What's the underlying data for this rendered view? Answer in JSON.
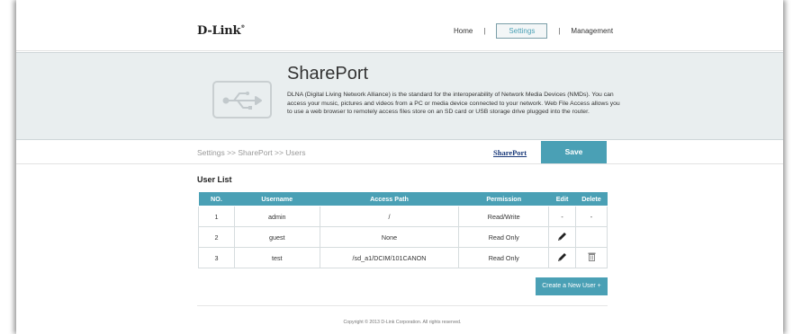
{
  "brand": {
    "logo": "D-Link",
    "logo_mark": "®"
  },
  "nav": {
    "home": "Home",
    "settings": "Settings",
    "management": "Management",
    "separator": "|"
  },
  "banner": {
    "title": "SharePort",
    "description": "DLNA (Digital Living Network Alliance) is the standard for the interoperability of Network Media Devices (NMDs). You can access your music, pictures and videos from a PC or media device connected to your network. Web File Access allows you to use a web browser to remotely access files store on an SD card or USB storage drive plugged into the router.",
    "icon": "usb-icon"
  },
  "breadcrumb": "Settings >> SharePort >> Users",
  "actions": {
    "shareport_link": "SharePort",
    "save": "Save",
    "create_user": "Create a New User +"
  },
  "section_title": "User List",
  "table": {
    "columns": [
      "NO.",
      "Username",
      "Access Path",
      "Permission",
      "Edit",
      "Delete"
    ],
    "rows": [
      {
        "no": "1",
        "username": "admin",
        "path": "/",
        "permission": "Read/Write",
        "edit": "-",
        "delete": "-"
      },
      {
        "no": "2",
        "username": "guest",
        "path": "None",
        "permission": "Read Only",
        "edit": "pencil-icon",
        "delete": ""
      },
      {
        "no": "3",
        "username": "test",
        "path": "/sd_a1/DCIM/101CANON",
        "permission": "Read Only",
        "edit": "pencil-icon",
        "delete": "trash-icon"
      }
    ]
  },
  "footer": {
    "copyright": "Copyright © 2013 D-Link Corporation. All rights reserved."
  },
  "colors": {
    "accent": "#4aa0b5",
    "banner_bg": "#e9eeef",
    "link": "#1a3a7a"
  }
}
